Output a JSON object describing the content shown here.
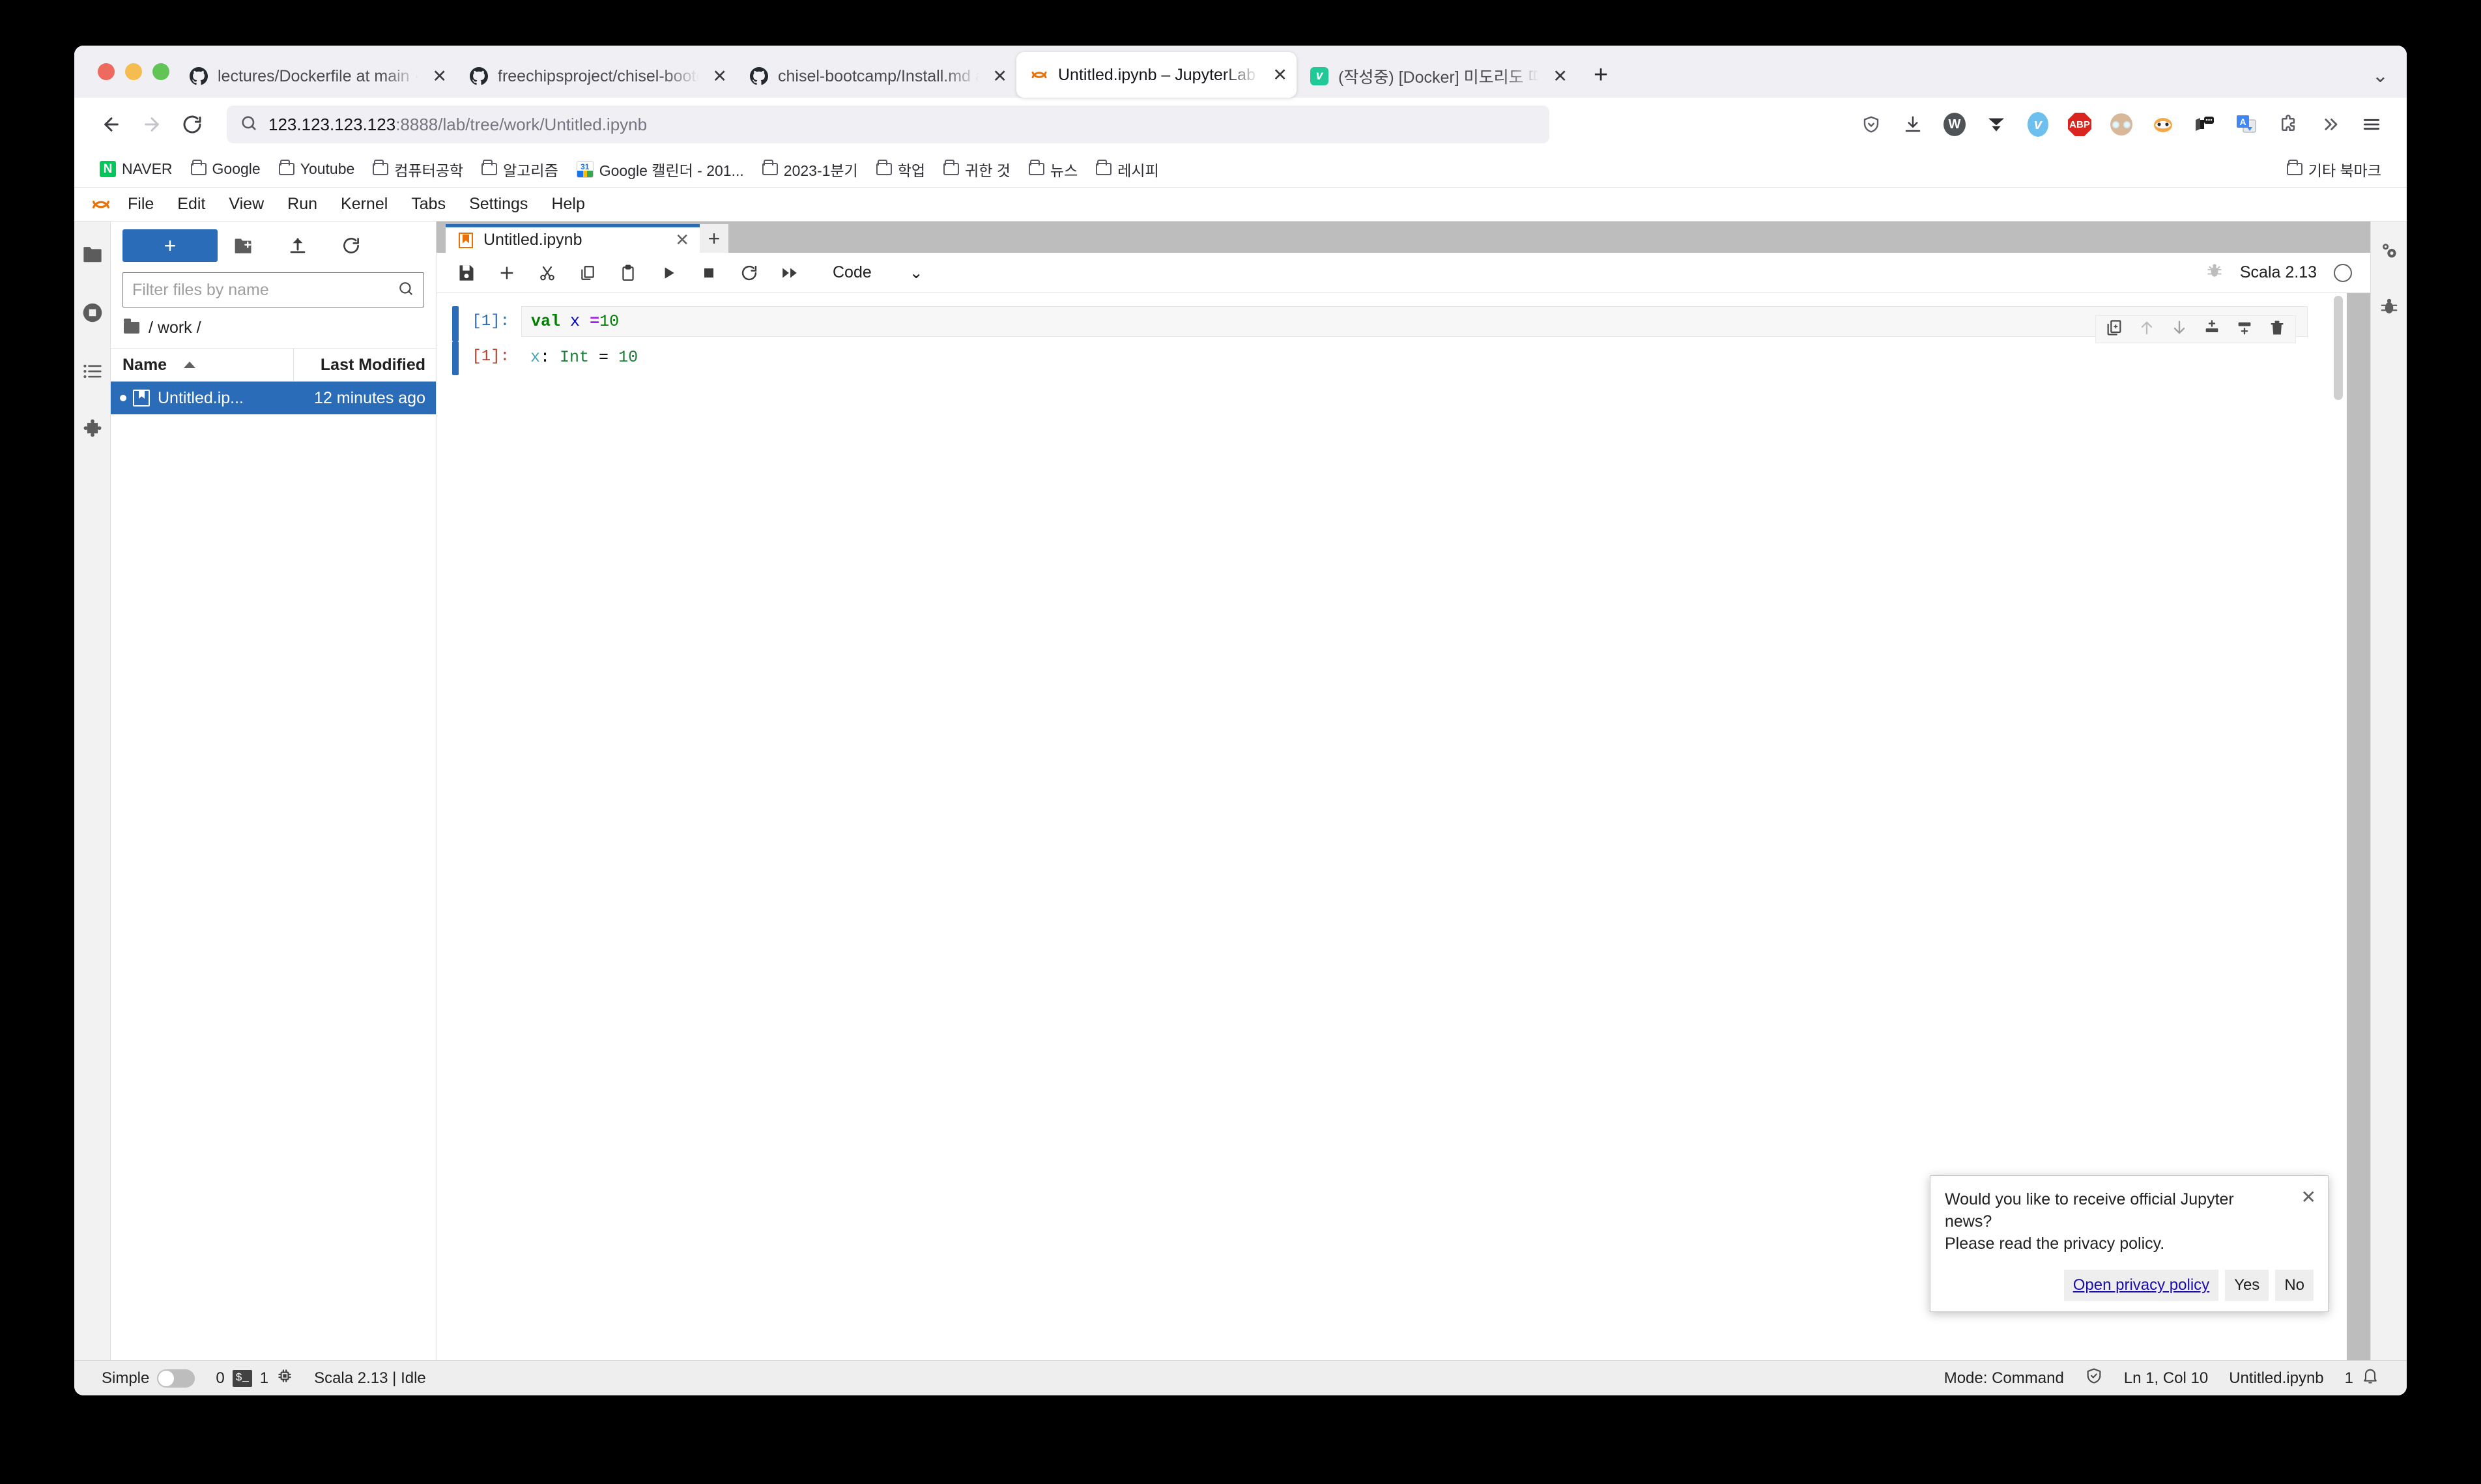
{
  "browser": {
    "tabs": [
      {
        "title": "lectures/Dockerfile at main · agi",
        "favicon": "github-icon",
        "active": false
      },
      {
        "title": "freechipsproject/chisel-bootcam",
        "favicon": "github-icon",
        "active": false
      },
      {
        "title": "chisel-bootcamp/Install.md at m",
        "favicon": "github-icon",
        "active": false
      },
      {
        "title": "Untitled.ipynb – JupyterLab",
        "favicon": "jupyter-icon",
        "active": true
      },
      {
        "title": "(작성중) [Docker] 미도리도 따라할 수",
        "favicon": "velog-icon",
        "active": false
      }
    ],
    "new_tab_label": "+",
    "tab_list_label": "⌄",
    "url": {
      "host": "123.123.123.123",
      "rest": ":8888/lab/tree/work/Untitled.ipynb"
    },
    "toolbar_icons": [
      "shield-icon",
      "downloads-icon",
      "w-circle-icon",
      "v-triangle-icon",
      "velog-icon",
      "adblockplus-icon",
      "avatar-icon",
      "privacy-badger-icon",
      "read-aloud-icon",
      "google-translate-icon",
      "extensions-icon",
      "overflow-icon",
      "app-menu-icon"
    ],
    "nav_icons": [
      "back-icon",
      "forward-icon",
      "reload-icon"
    ],
    "bookmarks": [
      {
        "label": "NAVER",
        "icon": "naver-icon"
      },
      {
        "label": "Google",
        "icon": "folder-icon"
      },
      {
        "label": "Youtube",
        "icon": "folder-icon"
      },
      {
        "label": "컴퓨터공학",
        "icon": "folder-icon"
      },
      {
        "label": "알고리즘",
        "icon": "folder-icon"
      },
      {
        "label": "Google 캘린더 - 201...",
        "icon": "gcal-icon"
      },
      {
        "label": "2023-1분기",
        "icon": "folder-icon"
      },
      {
        "label": "학업",
        "icon": "folder-icon"
      },
      {
        "label": "귀한 것",
        "icon": "folder-icon"
      },
      {
        "label": "뉴스",
        "icon": "folder-icon"
      },
      {
        "label": "레시피",
        "icon": "folder-icon"
      }
    ],
    "bookmarks_right": {
      "label": "기타 북마크",
      "icon": "folder-icon"
    }
  },
  "jupyter": {
    "menu": [
      "File",
      "Edit",
      "View",
      "Run",
      "Kernel",
      "Tabs",
      "Settings",
      "Help"
    ],
    "activity_bar": [
      "file-browser-icon",
      "running-terminals-icon",
      "table-of-contents-icon",
      "extension-manager-icon"
    ],
    "right_bar": [
      "property-inspector-icon",
      "debugger-icon"
    ],
    "file_browser": {
      "new_launcher_label": "+",
      "tools": [
        "new-folder-icon",
        "upload-icon",
        "refresh-icon"
      ],
      "filter_placeholder": "Filter files by name",
      "breadcrumb": "/ work /",
      "columns": [
        "Name",
        "Last Modified"
      ],
      "rows": [
        {
          "name": "Untitled.ip...",
          "modified": "12 minutes ago",
          "selected": true
        }
      ]
    },
    "dock": {
      "tab_title": "Untitled.ipynb",
      "tab_close": "✕",
      "add_tab": "+"
    },
    "notebook_toolbar": {
      "icons": [
        "save-icon",
        "insert-cell-icon",
        "cut-icon",
        "copy-icon",
        "paste-icon",
        "run-icon",
        "stop-icon",
        "restart-icon",
        "restart-run-all-icon"
      ],
      "cell_type": "Code",
      "cell_type_caret": "⌄",
      "debugger_label": "bug-icon",
      "kernel_name": "Scala 2.13",
      "kernel_status": "idle-circle-icon"
    },
    "cell_actions": [
      "duplicate-cell-icon",
      "move-cell-up-icon",
      "move-cell-down-icon",
      "insert-cell-above-icon",
      "insert-cell-below-icon",
      "delete-cell-icon"
    ],
    "cells": [
      {
        "type": "input",
        "prompt": "[1]:",
        "code_tokens": [
          {
            "t": "val",
            "c": "kw"
          },
          {
            "t": " ",
            "c": "plain"
          },
          {
            "t": "x",
            "c": "var"
          },
          {
            "t": " ",
            "c": "plain"
          },
          {
            "t": "=",
            "c": "op"
          },
          {
            "t": "10",
            "c": "num"
          }
        ]
      },
      {
        "type": "output",
        "prompt": "[1]:",
        "out_tokens": [
          {
            "t": "x",
            "c": "oname"
          },
          {
            "t": ": ",
            "c": "plain"
          },
          {
            "t": "Int",
            "c": "otype"
          },
          {
            "t": " = ",
            "c": "plain"
          },
          {
            "t": "10",
            "c": "otype"
          }
        ]
      }
    ],
    "notification": {
      "line1": "Would you like to receive official Jupyter news?",
      "line2": "Please read the privacy policy.",
      "close": "✕",
      "buttons": [
        "Open privacy policy",
        "Yes",
        "No"
      ]
    },
    "status_bar": {
      "simple_label": "Simple",
      "terminals_count": "0",
      "terminal_icon": "terminal-icon",
      "kernels_count": "1",
      "kernel_icon": "cpu-icon",
      "kernel_status": "Scala 2.13 | Idle",
      "mode": "Mode: Command",
      "trust_icon": "trusted-icon",
      "cursor": "Ln 1, Col 10",
      "filename": "Untitled.ipynb",
      "notifications_count": "1",
      "bell_icon": "bell-icon"
    }
  },
  "colors": {
    "accent": "#2b6cb9",
    "jupyter_orange": "#e8710a",
    "naver_green": "#03c75a",
    "link": "#1a0dab"
  }
}
